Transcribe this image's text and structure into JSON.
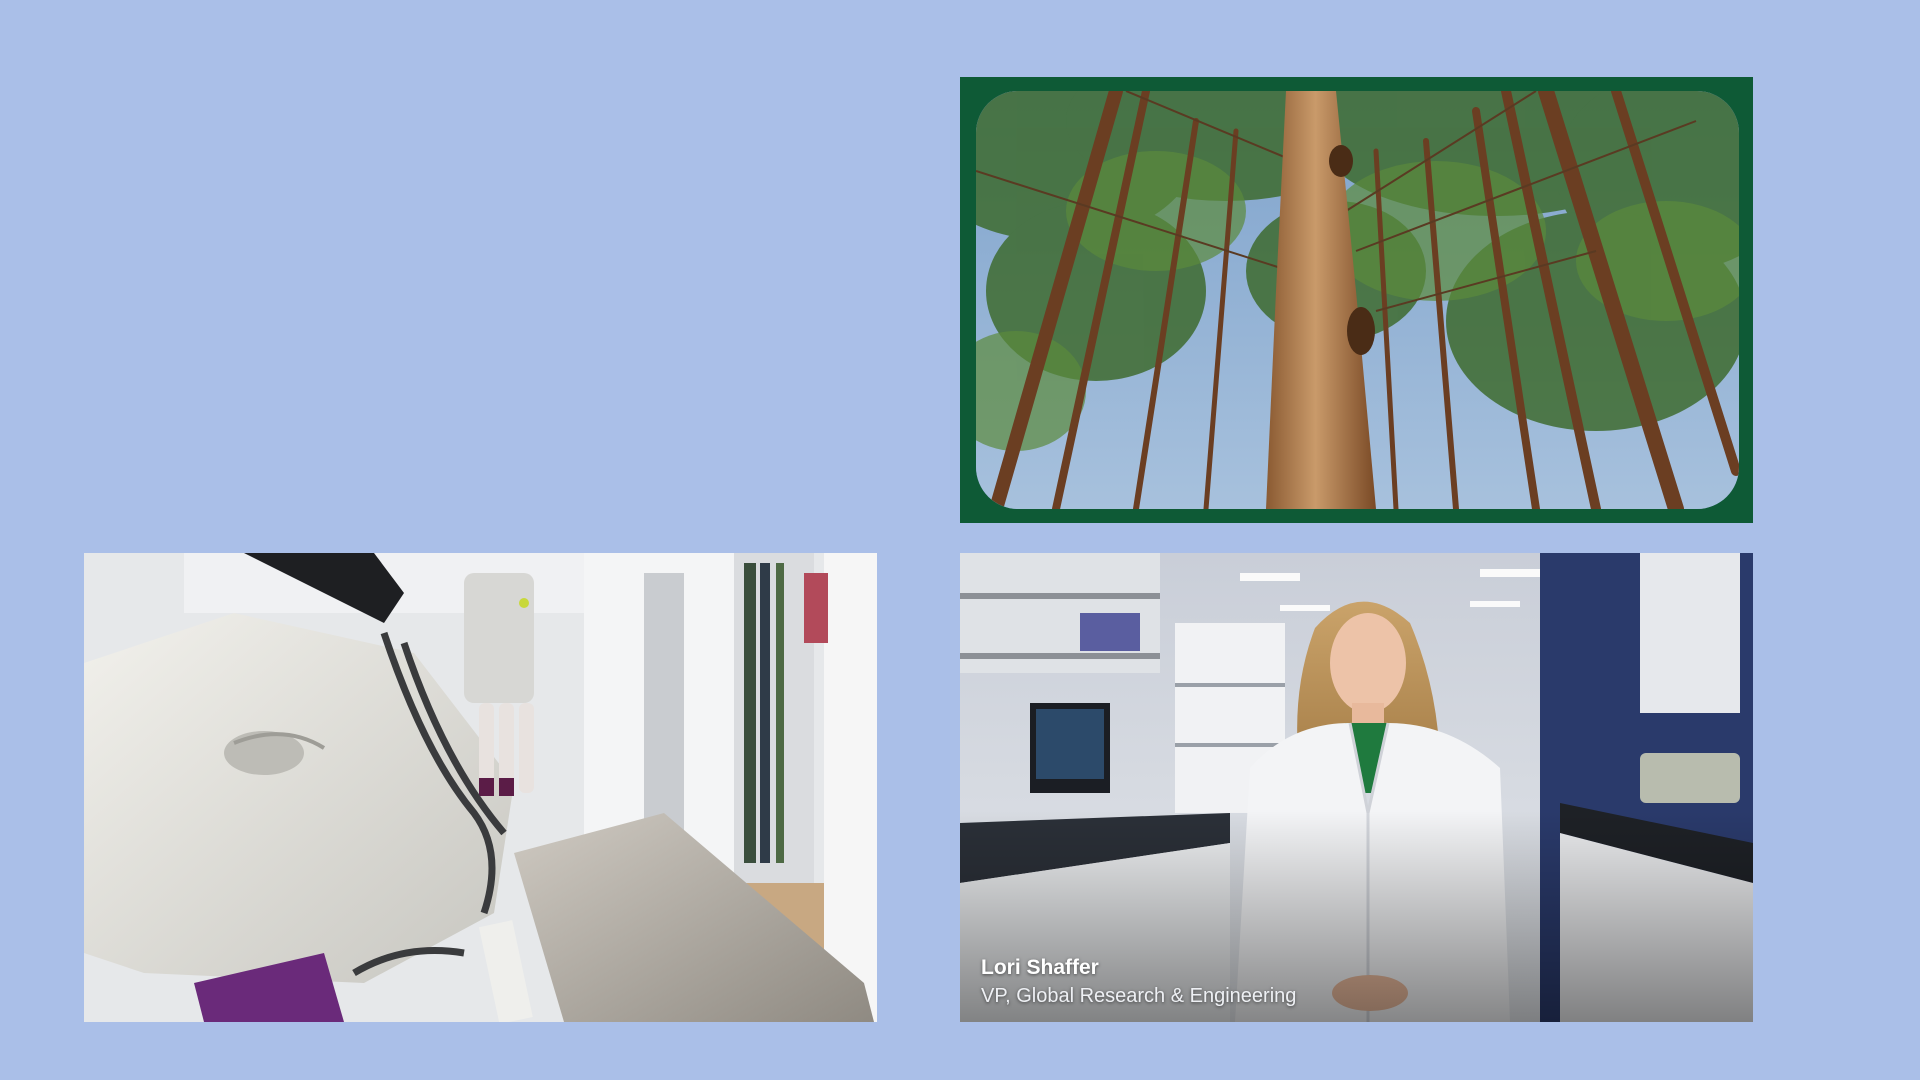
{
  "layout": {
    "background_color": "#aabfe8"
  },
  "tiles": {
    "forest": {
      "frame_color": "#0e5a36",
      "scene": "low-angle view of tall pine trees and sky"
    },
    "robot": {
      "scene": "white industrial robot arm holding sample vials in a lab"
    },
    "speaker": {
      "scene": "woman in white lab coat in a laboratory",
      "name": "Lori Shaffer",
      "title": "VP, Global Research & Engineering"
    }
  }
}
